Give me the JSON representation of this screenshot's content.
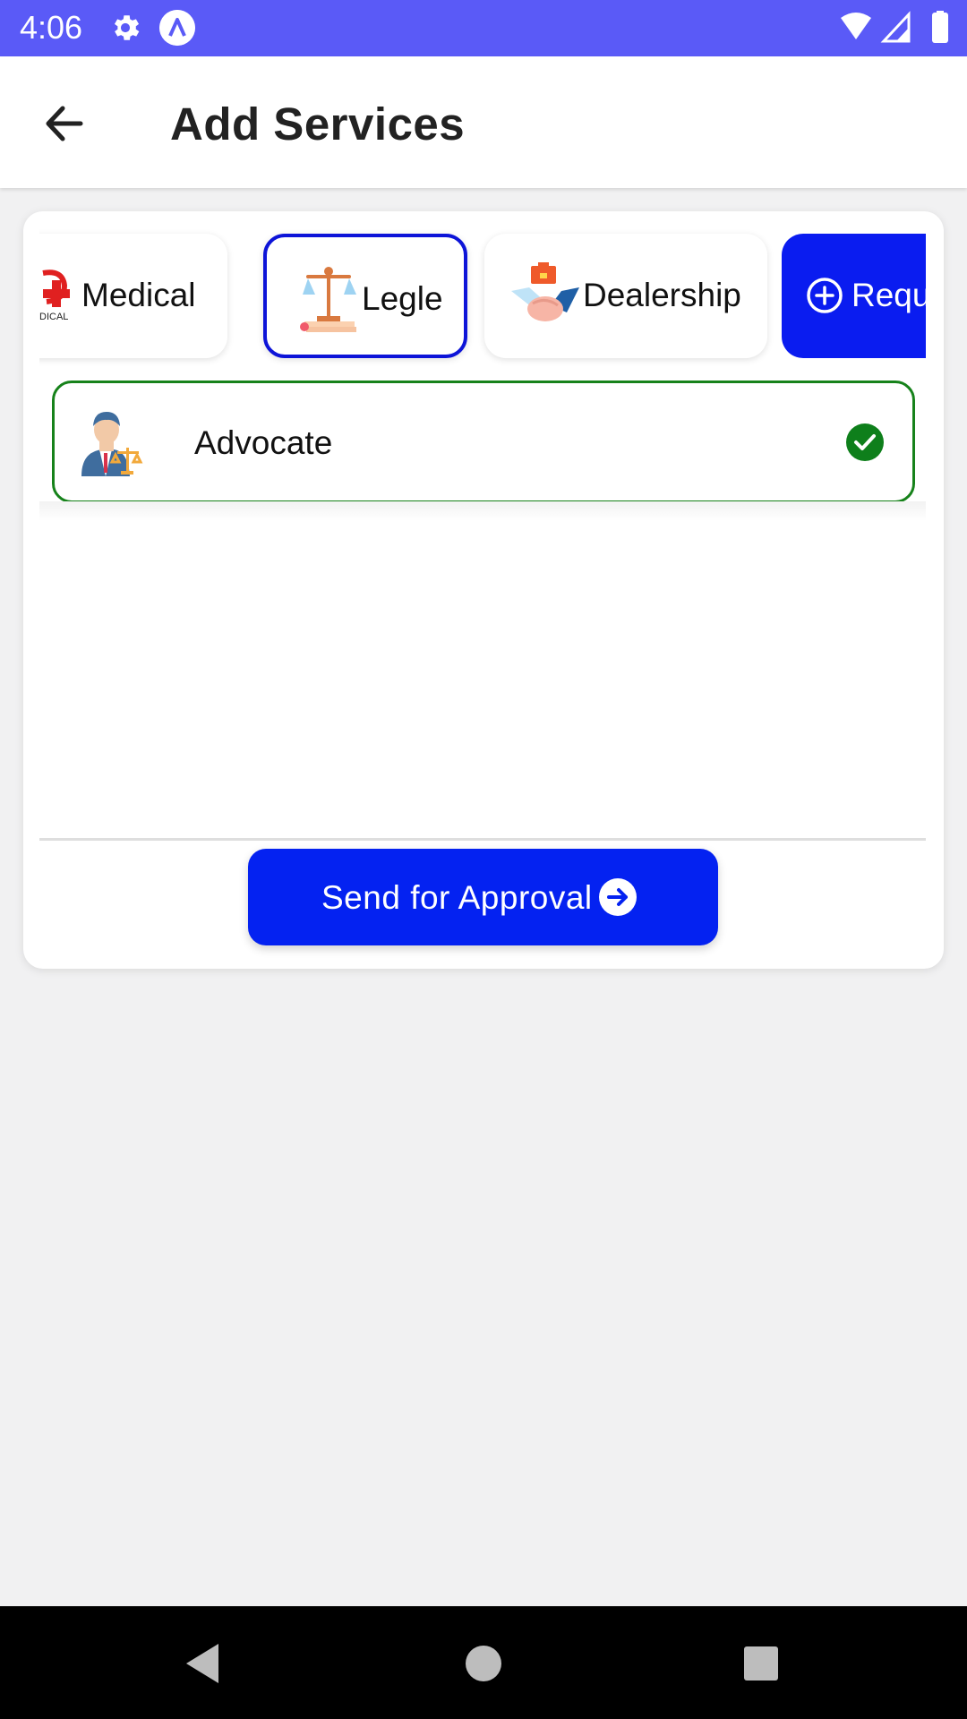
{
  "status_bar": {
    "time": "4:06",
    "icons": [
      "gear-icon",
      "accessibility-a-icon",
      "wifi-icon",
      "signal-icon",
      "battery-icon"
    ],
    "color": "#5a5af7"
  },
  "app_bar": {
    "back_icon": "arrow-left-icon",
    "title": "Add Services"
  },
  "categories": [
    {
      "label": "Medical",
      "icon": "medical-logo-icon",
      "selected": false
    },
    {
      "label": "Legle",
      "icon": "scales-of-justice-icon",
      "selected": true
    },
    {
      "label": "Dealership",
      "icon": "handshake-briefcase-icon",
      "selected": false
    }
  ],
  "request_chip": {
    "label": "Reques",
    "icon": "plus-circle-icon",
    "color": "#0a1cf0"
  },
  "services": [
    {
      "label": "Advocate",
      "icon": "advocate-avatar-icon",
      "checked": true
    }
  ],
  "approve_button": {
    "label": "Send for Approval",
    "icon": "arrow-right-circle-icon",
    "color": "#0422f1"
  },
  "nav_bar": {
    "icons": [
      "back-triangle-icon",
      "home-circle-icon",
      "recents-square-icon"
    ]
  },
  "colors": {
    "selected_border": "#0d14d8",
    "checked_green": "#16821a"
  }
}
